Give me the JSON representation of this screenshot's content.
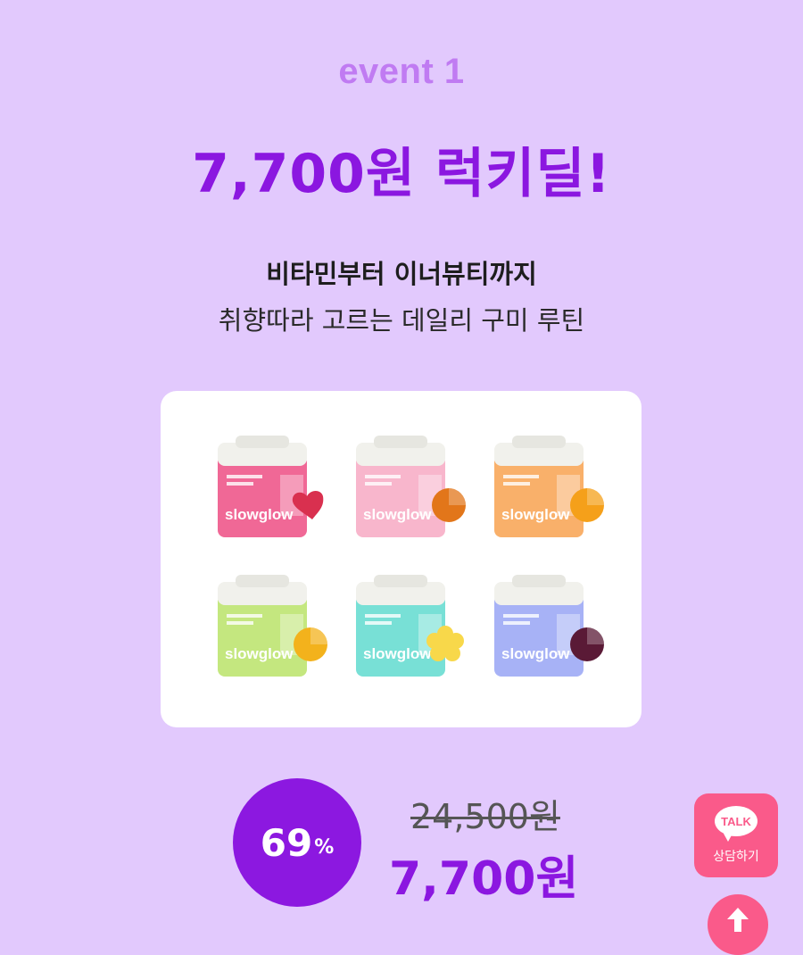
{
  "event": {
    "label": "event 1"
  },
  "headline": "7,700원 럭키딜!",
  "subtitle": {
    "line1": "비타민부터 이너뷰티까지",
    "line2": "취향따라 고르는 데일리 구미 루틴"
  },
  "products": [
    {
      "brand": "slowglow",
      "color": "#f06896",
      "gummy_color": "#d9304f",
      "gummy_shape": "heart"
    },
    {
      "brand": "slowglow",
      "color": "#f8b6cc",
      "gummy_color": "#e2761a",
      "gummy_shape": "round"
    },
    {
      "brand": "slowglow",
      "color": "#f9b06a",
      "gummy_color": "#f5a01a",
      "gummy_shape": "round"
    },
    {
      "brand": "slowglow",
      "color": "#c4e77f",
      "gummy_color": "#f3b21c",
      "gummy_shape": "round"
    },
    {
      "brand": "slowglow",
      "color": "#78e0d6",
      "gummy_color": "#f8d84a",
      "gummy_shape": "flower"
    },
    {
      "brand": "slowglow",
      "color": "#a7b2f6",
      "gummy_color": "#5a1a36",
      "gummy_shape": "round"
    }
  ],
  "price": {
    "discount_number": "69",
    "discount_unit": "%",
    "original": "24,500원",
    "sale": "7,700원"
  },
  "floating": {
    "talk_icon_text": "TALK",
    "talk_label": "상담하기"
  },
  "colors": {
    "background": "#e2c9fd",
    "accent": "#8b17e0",
    "talk": "#fa5a8a"
  }
}
